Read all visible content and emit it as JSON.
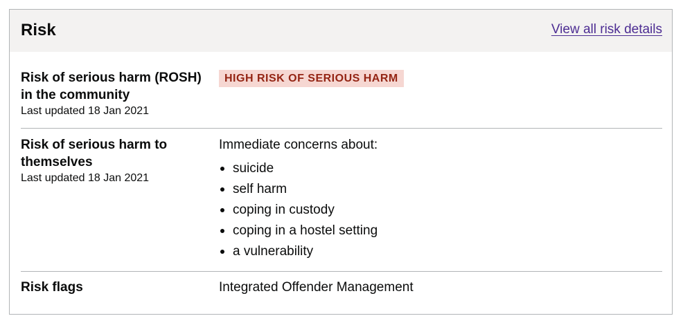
{
  "card": {
    "title": "Risk",
    "link_label": "View all risk details"
  },
  "rosh": {
    "label": "Risk of serious harm (ROSH) in the community",
    "updated": "Last updated 18 Jan 2021",
    "tag": "HIGH RISK OF SERIOUS HARM",
    "tag_color": "#942514",
    "tag_bg": "#f6d7d2"
  },
  "self_harm": {
    "label": "Risk of serious harm to themselves",
    "updated": "Last updated 18 Jan 2021",
    "intro": "Immediate concerns about:",
    "concerns": [
      "suicide",
      "self harm",
      "coping in custody",
      "coping in a hostel setting",
      "a vulnerability"
    ]
  },
  "flags": {
    "label": "Risk flags",
    "value": "Integrated Offender Management"
  },
  "colors": {
    "link": "#4c2c92",
    "header_bg": "#f3f2f1",
    "border": "#b1b4b6",
    "text": "#0b0c0c"
  }
}
